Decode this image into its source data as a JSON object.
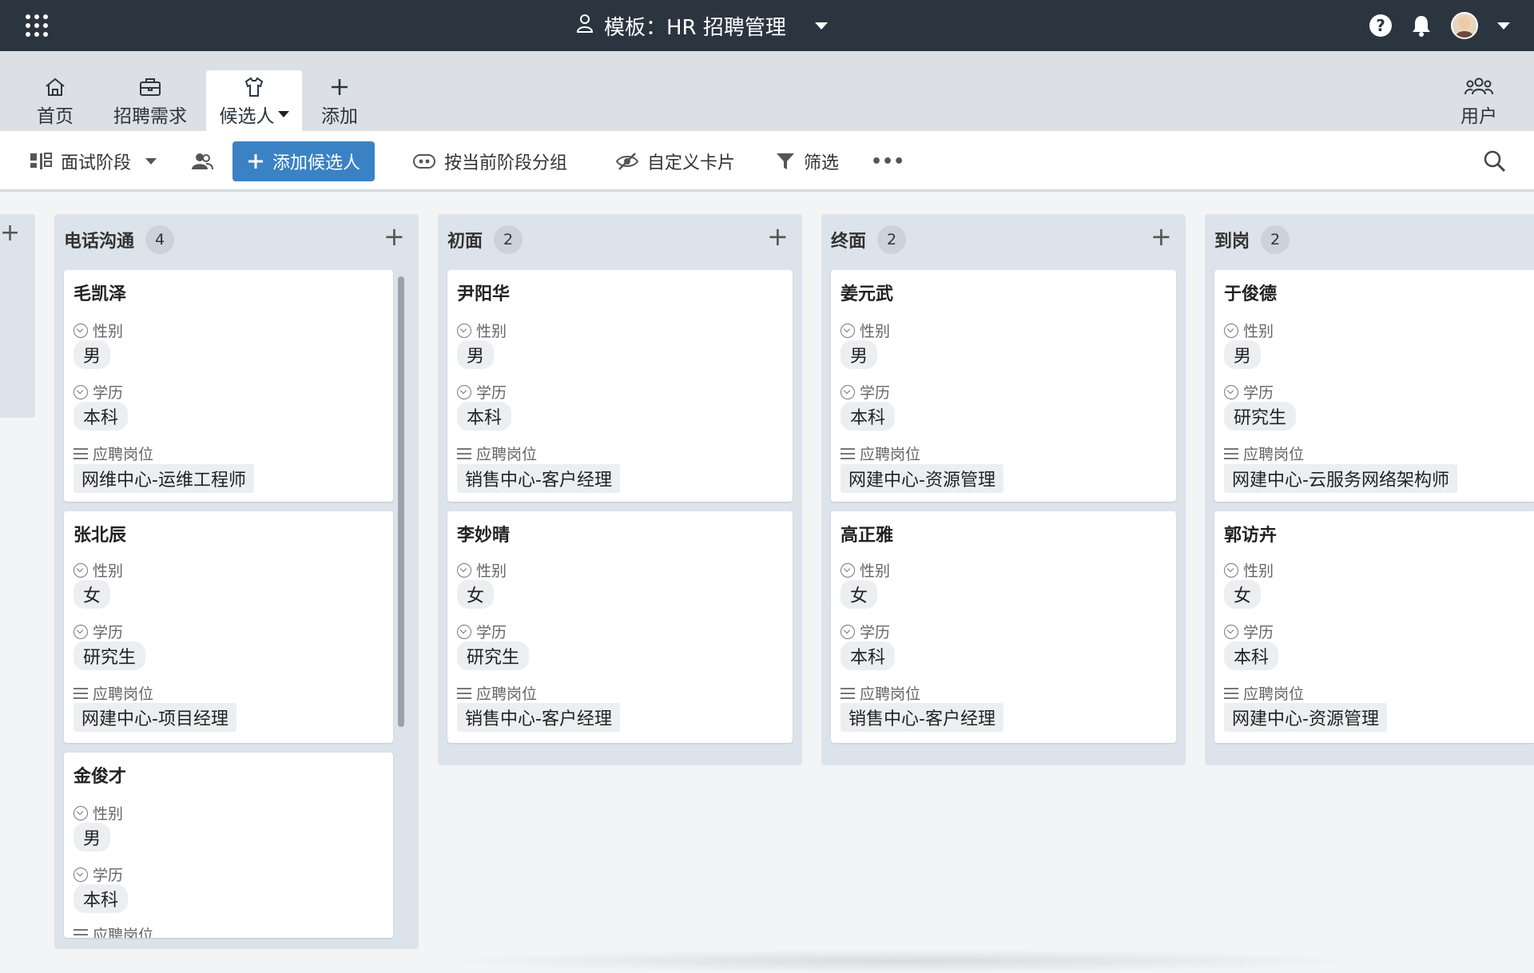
{
  "topbar": {
    "title": "模板：HR 招聘管理",
    "help": "?"
  },
  "nav": {
    "tabs": [
      {
        "label": "首页",
        "icon": "home-icon"
      },
      {
        "label": "招聘需求",
        "icon": "briefcase-icon"
      },
      {
        "label": "候选人",
        "icon": "shirt-icon"
      },
      {
        "label": "添加",
        "icon": "plus-icon"
      }
    ],
    "users": "用户"
  },
  "toolbar": {
    "view": "面试阶段",
    "add_candidate": "添加候选人",
    "group_by": "按当前阶段分组",
    "customize_card": "自定义卡片",
    "filter": "筛选",
    "more": "•••"
  },
  "labels": {
    "gender": "性别",
    "education": "学历",
    "position": "应聘岗位"
  },
  "columns": [
    {
      "title": "电话沟通",
      "count": "4",
      "cards": [
        {
          "name": "毛凯泽",
          "gender": "男",
          "education": "本科",
          "position": "网维中心-运维工程师"
        },
        {
          "name": "张北辰",
          "gender": "女",
          "education": "研究生",
          "position": "网建中心-项目经理"
        },
        {
          "name": "金俊才",
          "gender": "男",
          "education": "本科",
          "position": ""
        }
      ]
    },
    {
      "title": "初面",
      "count": "2",
      "cards": [
        {
          "name": "尹阳华",
          "gender": "男",
          "education": "本科",
          "position": "销售中心-客户经理"
        },
        {
          "name": "李妙晴",
          "gender": "女",
          "education": "研究生",
          "position": "销售中心-客户经理"
        }
      ]
    },
    {
      "title": "终面",
      "count": "2",
      "cards": [
        {
          "name": "姜元武",
          "gender": "男",
          "education": "本科",
          "position": "网建中心-资源管理"
        },
        {
          "name": "高正雅",
          "gender": "女",
          "education": "本科",
          "position": "销售中心-客户经理"
        }
      ]
    },
    {
      "title": "到岗",
      "count": "2",
      "cards": [
        {
          "name": "于俊德",
          "gender": "男",
          "education": "研究生",
          "position": "网建中心-云服务网络架构师"
        },
        {
          "name": "郭访卉",
          "gender": "女",
          "education": "本科",
          "position": "网建中心-资源管理"
        }
      ]
    }
  ]
}
